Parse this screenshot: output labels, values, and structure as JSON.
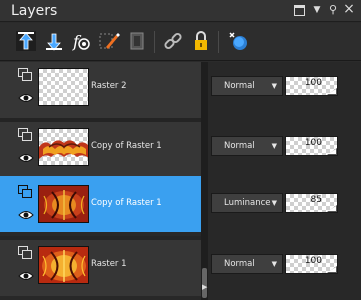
{
  "panel": {
    "title": "Layers",
    "window_controls": [
      "restore-icon",
      "menu-icon",
      "pin-icon",
      "close-icon"
    ]
  },
  "toolbar": {
    "buttons": [
      {
        "name": "move-layer-up-icon",
        "color": "#4aa8ff"
      },
      {
        "name": "move-layer-down-icon",
        "color": "#4aa8ff"
      },
      {
        "name": "layer-effects-icon",
        "color": "#ffffff"
      },
      {
        "name": "edit-selection-icon",
        "color": "#ffffff"
      },
      {
        "name": "mask-icon",
        "color": "#888888"
      },
      {
        "name": "link-icon",
        "color": "#bbbbbb"
      },
      {
        "name": "lock-icon",
        "color": "#f2b700"
      },
      {
        "name": "new-layer-icon",
        "color": "#4aa8ff"
      }
    ]
  },
  "layers": [
    {
      "name": "Raster 2",
      "blend_mode": "Normal",
      "opacity": "100",
      "selected": false,
      "thumbnail": "transparent"
    },
    {
      "name": "Copy of Raster 1",
      "blend_mode": "Normal",
      "opacity": "100",
      "selected": false,
      "thumbnail": "partial-pattern"
    },
    {
      "name": "Copy of Raster 1",
      "blend_mode": "Luminance",
      "opacity": "85",
      "selected": true,
      "thumbnail": "pattern"
    },
    {
      "name": "Raster 1",
      "blend_mode": "Normal",
      "opacity": "100",
      "selected": false,
      "thumbnail": "pattern"
    }
  ],
  "colors": {
    "selection": "#3aa0f0",
    "panel_bg": "#2b2b2b"
  }
}
